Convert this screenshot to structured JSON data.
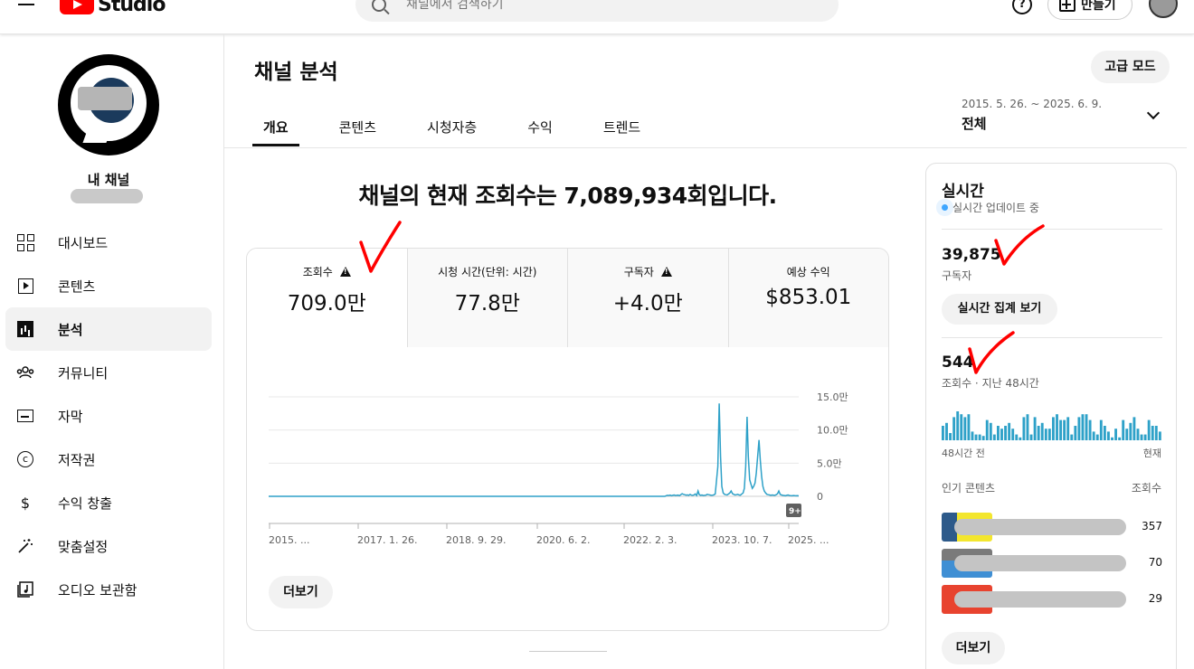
{
  "topbar": {
    "logo_text": "Studio",
    "search_placeholder": "채널에서 검색하기",
    "help_glyph": "?",
    "create_label": "만들기"
  },
  "sidebar": {
    "channel_label": "내 채널",
    "items": [
      {
        "label": "대시보드",
        "icon": "dashboard-icon"
      },
      {
        "label": "콘텐츠",
        "icon": "content-icon"
      },
      {
        "label": "분석",
        "icon": "analytics-icon",
        "active": true
      },
      {
        "label": "커뮤니티",
        "icon": "community-icon"
      },
      {
        "label": "자막",
        "icon": "subtitles-icon"
      },
      {
        "label": "저작권",
        "icon": "copyright-icon"
      },
      {
        "label": "수익 창출",
        "icon": "dollar-icon"
      },
      {
        "label": "맞춤설정",
        "icon": "magic-wand-icon"
      },
      {
        "label": "오디오 보관함",
        "icon": "audio-library-icon"
      }
    ]
  },
  "header": {
    "title": "채널 분석",
    "advanced_label": "고급 모드",
    "tabs": [
      "개요",
      "콘텐츠",
      "시청자층",
      "수익",
      "트렌드"
    ],
    "date_range": "2015. 5. 26. ~ 2025. 6. 9.",
    "date_label": "전체"
  },
  "overview": {
    "headline": "채널의 현재 조회수는 7,089,934회입니다.",
    "metrics": [
      {
        "label": "조회수",
        "value": "709.0만",
        "warning": true
      },
      {
        "label": "시청 시간(단위: 시간)",
        "value": "77.8만",
        "warning": false
      },
      {
        "label": "구독자",
        "value": "+4.0만",
        "warning": true
      },
      {
        "label": "예상 수익",
        "value": "$853.01",
        "warning": false
      }
    ],
    "more_label": "더보기",
    "badge": "9+"
  },
  "chart_data": {
    "type": "line",
    "x_tick_labels": [
      "2015. ...",
      "2017. 1. 26.",
      "2018. 9. 29.",
      "2020. 6. 2.",
      "2022. 2. 3.",
      "2023. 10. 7.",
      "2025. ..."
    ],
    "y_tick_labels": [
      "15.0만",
      "10.0만",
      "5.0만",
      "0"
    ],
    "ylim": [
      0,
      150000
    ],
    "grid": true,
    "series": [
      {
        "values": [
          0,
          0,
          0,
          0,
          0,
          0,
          0,
          0,
          0,
          0,
          0,
          0,
          0,
          0,
          0,
          0,
          0,
          0,
          0,
          0,
          0,
          0,
          0,
          0,
          0,
          0,
          0,
          0,
          0,
          0,
          0,
          0,
          0,
          0,
          0,
          0,
          0,
          0,
          0,
          0,
          0,
          0,
          0,
          0,
          0,
          0,
          0,
          0,
          0,
          0,
          0,
          0,
          0,
          0,
          0,
          0,
          0,
          0,
          0,
          0,
          0,
          0,
          0,
          0,
          0,
          0,
          0,
          0,
          0,
          0,
          0,
          0,
          0,
          0,
          0,
          0,
          0,
          0,
          0,
          0,
          0,
          0,
          0,
          0,
          0,
          0,
          0,
          0,
          0,
          0,
          0,
          0,
          0,
          0,
          0,
          0,
          0,
          0,
          0,
          0,
          0,
          0,
          0,
          0,
          0,
          0,
          0,
          0,
          0,
          0,
          0,
          0,
          0,
          0,
          0,
          0,
          0,
          0,
          0,
          0,
          0,
          0,
          0,
          0,
          0,
          0,
          0,
          0,
          0,
          0,
          0,
          0,
          0,
          0,
          0,
          0,
          0,
          0,
          0,
          0,
          0,
          0,
          0,
          0,
          0,
          0,
          0,
          0,
          0,
          0,
          0,
          0,
          0,
          0,
          0,
          0,
          0,
          0,
          0,
          0,
          0,
          0,
          0,
          0,
          0,
          0,
          0,
          0,
          0,
          0,
          0,
          0,
          0,
          0,
          0,
          0,
          0,
          0,
          0,
          0,
          0,
          0,
          0,
          0,
          0,
          0,
          0,
          0,
          0,
          0,
          0,
          0,
          0,
          0,
          0,
          0,
          0,
          0,
          0,
          0,
          0,
          0,
          0,
          0,
          0,
          0,
          0,
          0,
          0,
          0,
          0,
          0,
          0,
          0,
          0,
          0,
          0,
          0,
          0,
          0,
          0,
          0,
          0,
          0,
          0,
          0,
          0,
          0,
          0,
          0,
          0,
          0,
          0,
          0,
          0,
          0,
          0,
          0,
          0,
          0,
          0,
          0,
          0,
          0,
          0,
          0,
          0,
          0,
          0,
          0,
          0,
          0,
          0,
          0,
          0,
          0,
          0,
          0,
          0,
          0,
          0,
          0,
          0,
          0,
          0,
          0,
          0,
          0,
          0,
          0,
          0,
          0,
          0,
          0,
          0,
          0,
          0,
          0,
          0,
          0,
          0,
          0,
          0,
          0,
          0,
          0,
          0,
          0,
          0,
          0,
          0,
          0,
          0,
          0,
          0,
          0,
          0,
          0,
          0,
          0,
          1000,
          1500,
          1200,
          1800,
          1000,
          1500,
          2000,
          1200,
          1500,
          1800,
          1000,
          2500,
          4000,
          3000,
          2500,
          1800,
          2200,
          1500,
          2800,
          1800,
          1500,
          2000,
          3500,
          1200,
          8000,
          2500,
          1500,
          2000,
          1200,
          1500,
          1800,
          3000,
          2500,
          2000,
          1500,
          1800,
          2200,
          3500,
          25000,
          45000,
          140000,
          60000,
          15000,
          5000,
          3000,
          2500,
          2000,
          3500,
          5000,
          8000,
          4000,
          3000,
          2000,
          2500,
          3000,
          2000,
          1800,
          3500,
          5000,
          12000,
          45000,
          120000,
          60000,
          25000,
          18000,
          12000,
          15000,
          20000,
          35000,
          60000,
          85000,
          55000,
          30000,
          15000,
          8000,
          5000,
          3000,
          2500,
          2000,
          1500,
          2000,
          1800,
          1500,
          2500,
          4000,
          8000,
          3000,
          2000,
          1500,
          1200,
          1000,
          1500,
          2000,
          1200,
          1000,
          800,
          1200,
          1000,
          800,
          900,
          700
        ]
      }
    ]
  },
  "realtime": {
    "title": "실시간",
    "live_text": "실시간 업데이트 중",
    "subscribers_value": "39,875",
    "subscribers_label": "구독자",
    "realtime_btn": "실시간 집계 보기",
    "views_value": "544",
    "views_label": "조회수 · 지난 48시간",
    "bars": [
      10,
      12,
      5,
      16,
      20,
      18,
      16,
      18,
      6,
      4,
      4,
      3,
      14,
      12,
      4,
      10,
      8,
      10,
      12,
      8,
      4,
      2,
      16,
      18,
      4,
      16,
      10,
      12,
      8,
      8,
      16,
      18,
      14,
      14,
      16,
      4,
      10,
      16,
      18,
      18,
      14,
      6,
      4,
      14,
      10,
      6,
      2,
      8,
      2,
      14,
      8,
      12,
      16,
      8,
      4,
      4,
      14,
      10,
      10,
      6
    ],
    "axis_start": "48시간 전",
    "axis_end": "현재",
    "popular_label": "인기 콘텐츠",
    "popular_metric": "조회수",
    "popular": [
      {
        "count": "357",
        "color": "#f3e62e"
      },
      {
        "count": "70",
        "color": "#3f8fd4"
      },
      {
        "count": "29",
        "color": "#e8432f"
      }
    ],
    "more_label": "더보기"
  },
  "colors": {
    "chart_line": "#2ea1c8",
    "rt_bar": "#2ea1c8",
    "annotation": "#ff0000"
  }
}
